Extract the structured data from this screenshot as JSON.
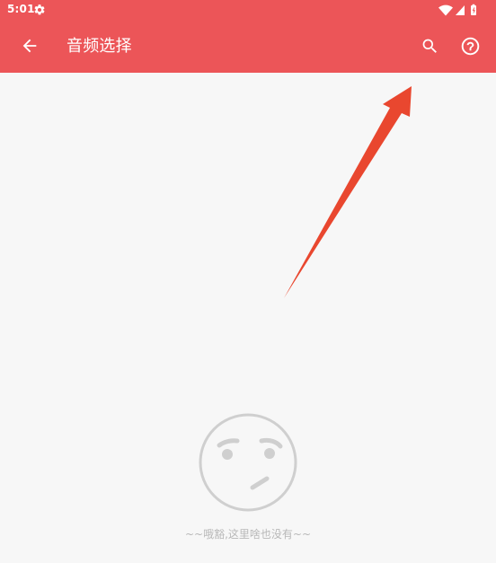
{
  "status_bar": {
    "time": "5:01",
    "icons": [
      "gear-icon",
      "wifi-icon",
      "signal-icon",
      "battery-icon"
    ]
  },
  "app_bar": {
    "title": "音频选择",
    "back_icon": "arrow-back-icon",
    "search_icon": "search-icon",
    "help_icon": "help-icon"
  },
  "empty_state": {
    "message": "~~哦豁,这里啥也没有~~",
    "icon": "confused-face-icon"
  },
  "colors": {
    "primary": "#ec5558",
    "background": "#f7f7f7",
    "empty_icon": "#c9c9c9",
    "annotation_arrow": "#e9472f"
  }
}
